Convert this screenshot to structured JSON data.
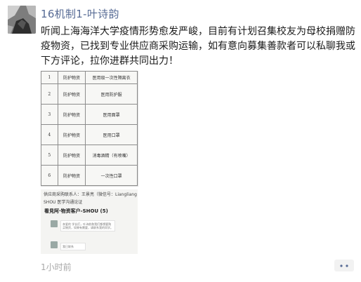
{
  "post": {
    "author": "16机制1-叶诗韵",
    "content_lines": [
      "听闻上海海洋大学疫情形势愈发严峻，目前有计划召集校友为母校捐赠防",
      "疫物资，已找到专业供应商采购运输，如有意向募集善款者可以私聊我或",
      "下方评论，拉你进群共同出力！"
    ],
    "time": "1小时前",
    "more_icon": "more-dots-icon"
  },
  "table_photo": {
    "rows": [
      {
        "no": "1",
        "type": "防护物资",
        "name": "医用级一次性隔离衣"
      },
      {
        "no": "2",
        "type": "防护物资",
        "name": "医用防护服"
      },
      {
        "no": "3",
        "type": "防护物资",
        "name": "医用面罩"
      },
      {
        "no": "4",
        "type": "防护物资",
        "name": "医用口罩"
      },
      {
        "no": "5",
        "type": "防护物资",
        "name": "消毒酒精（有喷嘴）"
      },
      {
        "no": "6",
        "type": "防护物资",
        "name": "一次性口罩"
      }
    ]
  },
  "chat_photo": {
    "line1": "供应商采购联系人：王景亮（微信号：Liangliang",
    "line2": "SHOU 医学沟通论证",
    "group_title": "看見阿·物资客户-SHOU (5)",
    "bubble1": "亲爱的 学长们，叶诗韵和我们都想要购买物资，如果有需要，请联系我的同学。",
    "bubble2": "我已联系"
  }
}
